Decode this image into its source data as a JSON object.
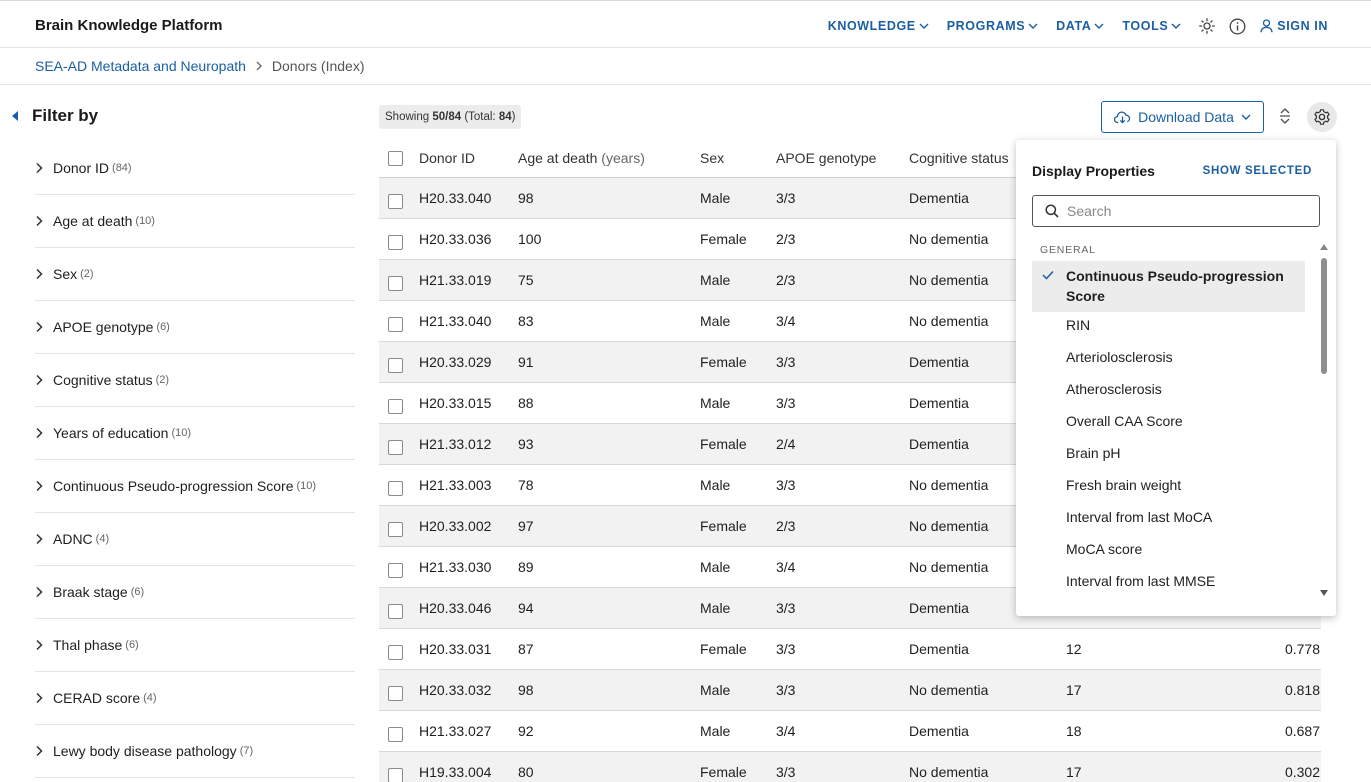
{
  "header": {
    "brand": "Brain Knowledge Platform",
    "nav": [
      "KNOWLEDGE",
      "PROGRAMS",
      "DATA",
      "TOOLS"
    ],
    "sign_in": "SIGN IN"
  },
  "breadcrumb": {
    "parent": "SEA-AD Metadata and Neuropath",
    "current": "Donors (Index)"
  },
  "sidebar": {
    "title": "Filter by",
    "filters": [
      {
        "label": "Donor ID",
        "count": "(84)"
      },
      {
        "label": "Age at death",
        "count": "(10)"
      },
      {
        "label": "Sex",
        "count": "(2)"
      },
      {
        "label": "APOE genotype",
        "count": "(6)"
      },
      {
        "label": "Cognitive status",
        "count": "(2)"
      },
      {
        "label": "Years of education",
        "count": "(10)"
      },
      {
        "label": "Continuous Pseudo-progression Score",
        "count": "(10)"
      },
      {
        "label": "ADNC",
        "count": "(4)"
      },
      {
        "label": "Braak stage",
        "count": "(6)"
      },
      {
        "label": "Thal phase",
        "count": "(6)"
      },
      {
        "label": "CERAD score",
        "count": "(4)"
      },
      {
        "label": "Lewy body disease pathology",
        "count": "(7)"
      }
    ]
  },
  "toolbar": {
    "showing_prefix": "Showing",
    "showing_count": "50/84",
    "showing_total_label": "(Total:",
    "showing_total": "84",
    "showing_suffix": ")",
    "download_label": "Download Data"
  },
  "table": {
    "headers": {
      "donor_id": "Donor ID",
      "age": "Age at death",
      "age_unit": "(years)",
      "sex": "Sex",
      "apoe": "APOE genotype",
      "cognitive": "Cognitive status"
    },
    "rows": [
      {
        "id": "H20.33.040",
        "age": "98",
        "sex": "Male",
        "apoe": "3/3",
        "cog": "Dementia",
        "edu": "",
        "cps": ""
      },
      {
        "id": "H20.33.036",
        "age": "100",
        "sex": "Female",
        "apoe": "2/3",
        "cog": "No dementia",
        "edu": "",
        "cps": ""
      },
      {
        "id": "H21.33.019",
        "age": "75",
        "sex": "Male",
        "apoe": "2/3",
        "cog": "No dementia",
        "edu": "",
        "cps": ""
      },
      {
        "id": "H21.33.040",
        "age": "83",
        "sex": "Male",
        "apoe": "3/4",
        "cog": "No dementia",
        "edu": "",
        "cps": ""
      },
      {
        "id": "H20.33.029",
        "age": "91",
        "sex": "Female",
        "apoe": "3/3",
        "cog": "Dementia",
        "edu": "",
        "cps": ""
      },
      {
        "id": "H20.33.015",
        "age": "88",
        "sex": "Male",
        "apoe": "3/3",
        "cog": "Dementia",
        "edu": "",
        "cps": ""
      },
      {
        "id": "H21.33.012",
        "age": "93",
        "sex": "Female",
        "apoe": "2/4",
        "cog": "Dementia",
        "edu": "",
        "cps": ""
      },
      {
        "id": "H21.33.003",
        "age": "78",
        "sex": "Male",
        "apoe": "3/3",
        "cog": "No dementia",
        "edu": "",
        "cps": ""
      },
      {
        "id": "H20.33.002",
        "age": "97",
        "sex": "Female",
        "apoe": "2/3",
        "cog": "No dementia",
        "edu": "",
        "cps": ""
      },
      {
        "id": "H21.33.030",
        "age": "89",
        "sex": "Male",
        "apoe": "3/4",
        "cog": "No dementia",
        "edu": "",
        "cps": ""
      },
      {
        "id": "H20.33.046",
        "age": "94",
        "sex": "Male",
        "apoe": "3/3",
        "cog": "Dementia",
        "edu": "",
        "cps": ""
      },
      {
        "id": "H20.33.031",
        "age": "87",
        "sex": "Female",
        "apoe": "3/3",
        "cog": "Dementia",
        "edu": "12",
        "cps": "0.778"
      },
      {
        "id": "H20.33.032",
        "age": "98",
        "sex": "Male",
        "apoe": "3/3",
        "cog": "No dementia",
        "edu": "17",
        "cps": "0.818"
      },
      {
        "id": "H21.33.027",
        "age": "92",
        "sex": "Male",
        "apoe": "3/4",
        "cog": "Dementia",
        "edu": "18",
        "cps": "0.687"
      },
      {
        "id": "H19.33.004",
        "age": "80",
        "sex": "Female",
        "apoe": "3/3",
        "cog": "No dementia",
        "edu": "17",
        "cps": "0.302"
      }
    ]
  },
  "popover": {
    "title": "Display Properties",
    "show_selected": "SHOW SELECTED",
    "search_placeholder": "Search",
    "group": "GENERAL",
    "items": [
      {
        "label": "Continuous Pseudo-progression Score",
        "selected": true
      },
      {
        "label": "RIN",
        "selected": false
      },
      {
        "label": "Arteriolosclerosis",
        "selected": false
      },
      {
        "label": "Atherosclerosis",
        "selected": false
      },
      {
        "label": "Overall CAA Score",
        "selected": false
      },
      {
        "label": "Brain pH",
        "selected": false
      },
      {
        "label": "Fresh brain weight",
        "selected": false
      },
      {
        "label": "Interval from last MoCA",
        "selected": false
      },
      {
        "label": "MoCA score",
        "selected": false
      },
      {
        "label": "Interval from last MMSE",
        "selected": false
      }
    ]
  },
  "colors": {
    "accent": "#1a5fa3",
    "row_alt": "#f2f2f2",
    "selected_bg": "#ececec"
  }
}
